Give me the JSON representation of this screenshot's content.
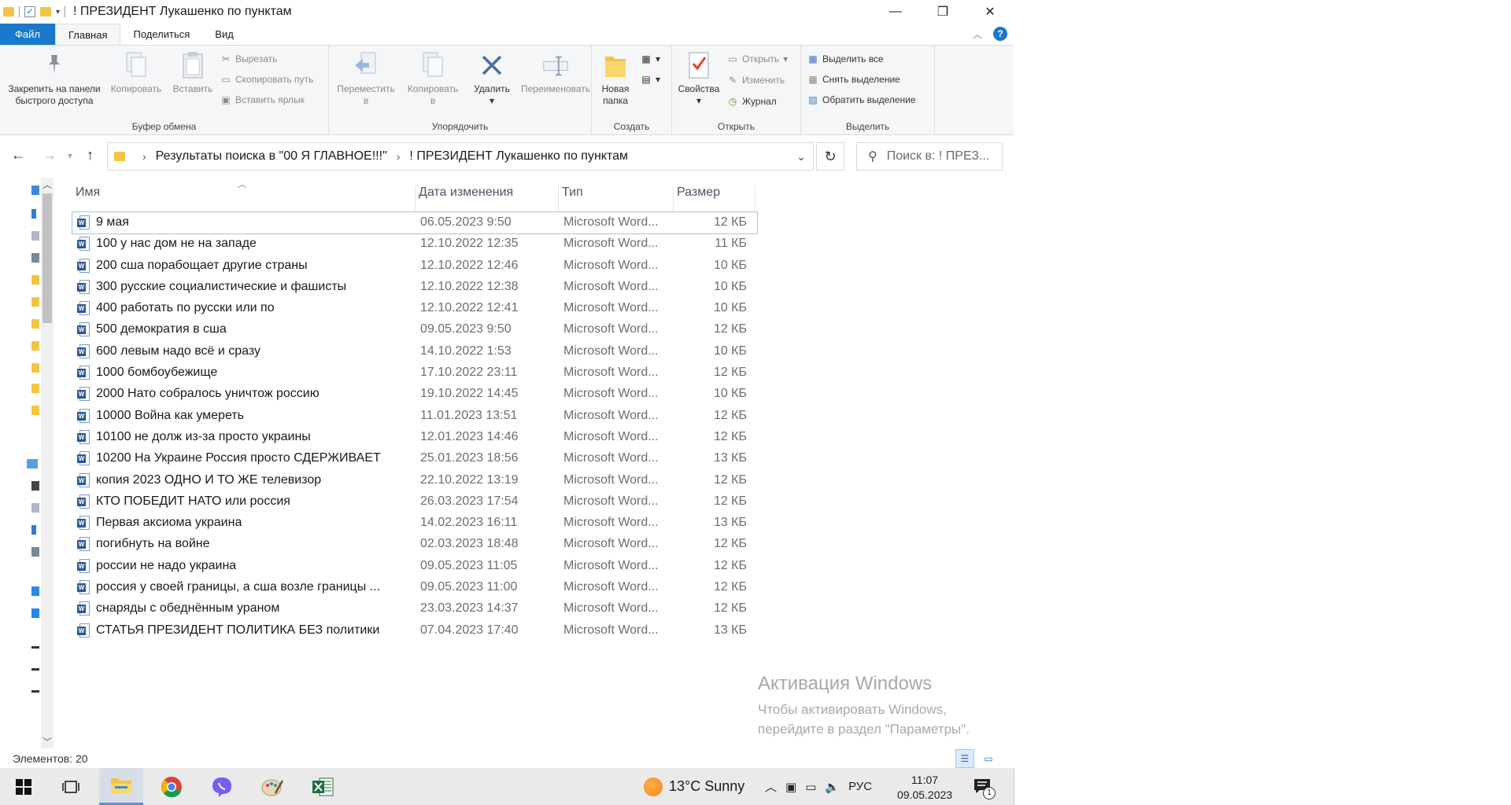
{
  "window": {
    "title": "! ПРЕЗИДЕНТ Лукашенко по пунктам"
  },
  "ribbon_tabs": [
    "Файл",
    "Главная",
    "Поделиться",
    "Вид"
  ],
  "ribbon": {
    "clipboard": {
      "pin_label_1": "Закрепить на панели",
      "pin_label_2": "быстрого доступа",
      "copy": "Копировать",
      "paste": "Вставить",
      "cut": "Вырезать",
      "copy_path": "Скопировать путь",
      "paste_shortcut": "Вставить ярлык",
      "group": "Буфер обмена"
    },
    "organize": {
      "move_1": "Переместить",
      "move_2": "в",
      "copy_to_1": "Копировать",
      "copy_to_2": "в",
      "delete": "Удалить",
      "rename": "Переименовать",
      "group": "Упорядочить"
    },
    "create": {
      "new_folder_1": "Новая",
      "new_folder_2": "папка",
      "group": "Создать"
    },
    "open": {
      "properties": "Свойства",
      "open": "Открыть",
      "edit": "Изменить",
      "history": "Журнал",
      "group": "Открыть"
    },
    "select": {
      "select_all": "Выделить все",
      "select_none": "Снять выделение",
      "invert": "Обратить выделение",
      "group": "Выделить"
    }
  },
  "address": {
    "crumb1": "Результаты поиска в \"00 Я ГЛАВНОЕ!!!\"",
    "crumb2": "! ПРЕЗИДЕНТ Лукашенко по пунктам",
    "search_placeholder": "Поиск в: ! ПРЕЗ..."
  },
  "columns": {
    "name": "Имя",
    "date": "Дата изменения",
    "type": "Тип",
    "size": "Размер"
  },
  "files": [
    {
      "name": "9 мая",
      "date": "06.05.2023 9:50",
      "type": "Microsoft Word...",
      "size": "12 КБ"
    },
    {
      "name": "100 у нас дом не на западе",
      "date": "12.10.2022 12:35",
      "type": "Microsoft Word...",
      "size": "11 КБ"
    },
    {
      "name": "200 сша порабощает другие страны",
      "date": "12.10.2022 12:46",
      "type": "Microsoft Word...",
      "size": "10 КБ"
    },
    {
      "name": "300 русские социалистические и фашисты",
      "date": "12.10.2022 12:38",
      "type": "Microsoft Word...",
      "size": "10 КБ"
    },
    {
      "name": "400 работать по русски или по",
      "date": "12.10.2022 12:41",
      "type": "Microsoft Word...",
      "size": "10 КБ"
    },
    {
      "name": "500 демократия в сша",
      "date": "09.05.2023 9:50",
      "type": "Microsoft Word...",
      "size": "12 КБ"
    },
    {
      "name": "600 левым надо всё и сразу",
      "date": "14.10.2022 1:53",
      "type": "Microsoft Word...",
      "size": "10 КБ"
    },
    {
      "name": "1000 бомбоубежище",
      "date": "17.10.2022 23:11",
      "type": "Microsoft Word...",
      "size": "12 КБ"
    },
    {
      "name": "2000 Нато собралось уничтож россию",
      "date": "19.10.2022 14:45",
      "type": "Microsoft Word...",
      "size": "10 КБ"
    },
    {
      "name": "10000 Война как умереть",
      "date": "11.01.2023 13:51",
      "type": "Microsoft Word...",
      "size": "12 КБ"
    },
    {
      "name": "10100 не долж из-за просто украины",
      "date": "12.01.2023 14:46",
      "type": "Microsoft Word...",
      "size": "12 КБ"
    },
    {
      "name": "10200 На Украине Россия просто СДЕРЖИВАЕТ",
      "date": "25.01.2023 18:56",
      "type": "Microsoft Word...",
      "size": "13 КБ"
    },
    {
      "name": "копия 2023 ОДНО И ТО ЖЕ телевизор",
      "date": "22.10.2022 13:19",
      "type": "Microsoft Word...",
      "size": "12 КБ"
    },
    {
      "name": "КТО ПОБЕДИТ НАТО или россия",
      "date": "26.03.2023 17:54",
      "type": "Microsoft Word...",
      "size": "12 КБ"
    },
    {
      "name": "Первая аксиома украина",
      "date": "14.02.2023 16:11",
      "type": "Microsoft Word...",
      "size": "13 КБ"
    },
    {
      "name": "погибнуть на войне",
      "date": "02.03.2023 18:48",
      "type": "Microsoft Word...",
      "size": "12 КБ"
    },
    {
      "name": "россии не надо украина",
      "date": "09.05.2023 11:05",
      "type": "Microsoft Word...",
      "size": "12 КБ"
    },
    {
      "name": "россия у своей границы, а сша возле границы ...",
      "date": "09.05.2023 11:00",
      "type": "Microsoft Word...",
      "size": "12 КБ"
    },
    {
      "name": "снаряды с обеднённым ураном",
      "date": "23.03.2023 14:37",
      "type": "Microsoft Word...",
      "size": "12 КБ"
    },
    {
      "name": "СТАТЬЯ ПРЕЗИДЕНТ ПОЛИТИКА БЕЗ политики",
      "date": "07.04.2023 17:40",
      "type": "Microsoft Word...",
      "size": "13 КБ"
    }
  ],
  "watermark": {
    "title": "Активация Windows",
    "line1": "Чтобы активировать Windows,",
    "line2": "перейдите в раздел \"Параметры\"."
  },
  "status": {
    "count": "Элементов: 20"
  },
  "taskbar": {
    "weather": "13°C  Sunny",
    "lang": "РУС",
    "time": "11:07",
    "date": "09.05.2023",
    "notif_count": "1"
  },
  "colors": {
    "file_tab": "#1979ca",
    "selection": "#99c7f0",
    "word_icon": "#2b5797"
  }
}
